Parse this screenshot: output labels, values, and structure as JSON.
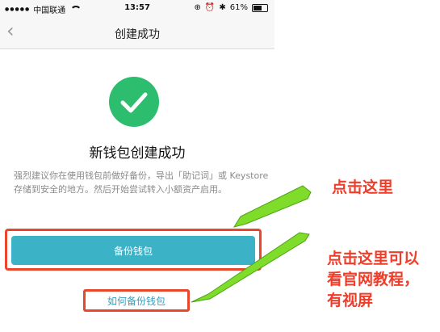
{
  "status_bar": {
    "carrier": "中国联通",
    "time": "13:57",
    "battery": "61%",
    "battery_level": 0.61
  },
  "nav": {
    "title": "创建成功",
    "back_icon": "chevron-left-icon"
  },
  "success": {
    "icon": "check-circle-icon",
    "heading": "新钱包创建成功"
  },
  "description": "强烈建议你在使用钱包前做好备份，导出「助记词」或 Keystore 存储到安全的地方。然后开始尝试转入小额资产启用。",
  "backup_button": {
    "label": "备份钱包"
  },
  "howto_link": {
    "label": "如何备份钱包"
  },
  "annotations": {
    "callout_1": "点击这里",
    "callout_2_lines": [
      "点击这里可以",
      "看官网教程，",
      "有视屏"
    ]
  },
  "colors": {
    "accent": "#3cb2c6",
    "success": "#2dbd6e",
    "highlight": "#e8472b",
    "arrow": "#7fdc2a",
    "link": "#2fa2c4"
  }
}
